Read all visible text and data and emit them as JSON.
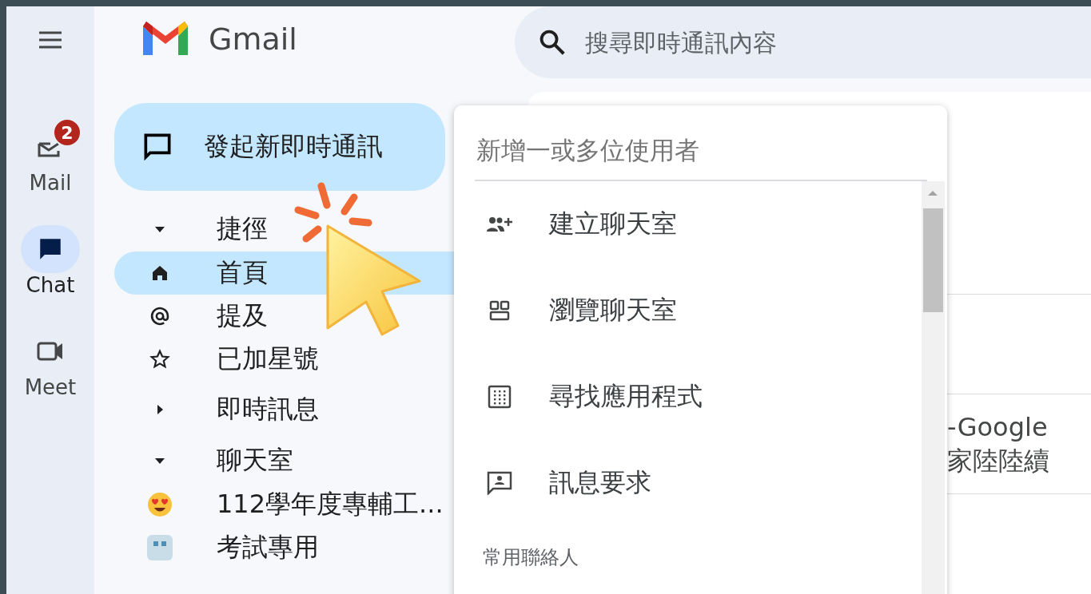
{
  "rail": {
    "items": [
      {
        "label": "Mail",
        "badge": "2",
        "selected": false
      },
      {
        "label": "Chat",
        "selected": true
      },
      {
        "label": "Meet",
        "selected": false
      }
    ]
  },
  "app": {
    "name": "Gmail"
  },
  "compose": {
    "label": "發起新即時通訊"
  },
  "nav": [
    {
      "label": "捷徑",
      "expanded": true,
      "children": [
        {
          "label": "首頁",
          "selected": true
        },
        {
          "label": "提及",
          "selected": false
        },
        {
          "label": "已加星號",
          "selected": false
        }
      ]
    },
    {
      "label": "即時訊息",
      "expanded": false
    },
    {
      "label": "聊天室",
      "expanded": true,
      "children": [
        {
          "label": "112學年度專輔工...",
          "selected": false
        },
        {
          "label": "考試專用",
          "selected": false
        }
      ]
    }
  ],
  "search": {
    "placeholder": "搜尋即時通訊內容"
  },
  "conversation": {
    "lines": [
      "-Google",
      "家陸陸續"
    ]
  },
  "popup": {
    "input": {
      "placeholder": "新增一或多位使用者"
    },
    "items": [
      "建立聊天室",
      "瀏覽聊天室",
      "尋找應用程式",
      "訊息要求"
    ],
    "section_heading": "常用聯絡人"
  }
}
